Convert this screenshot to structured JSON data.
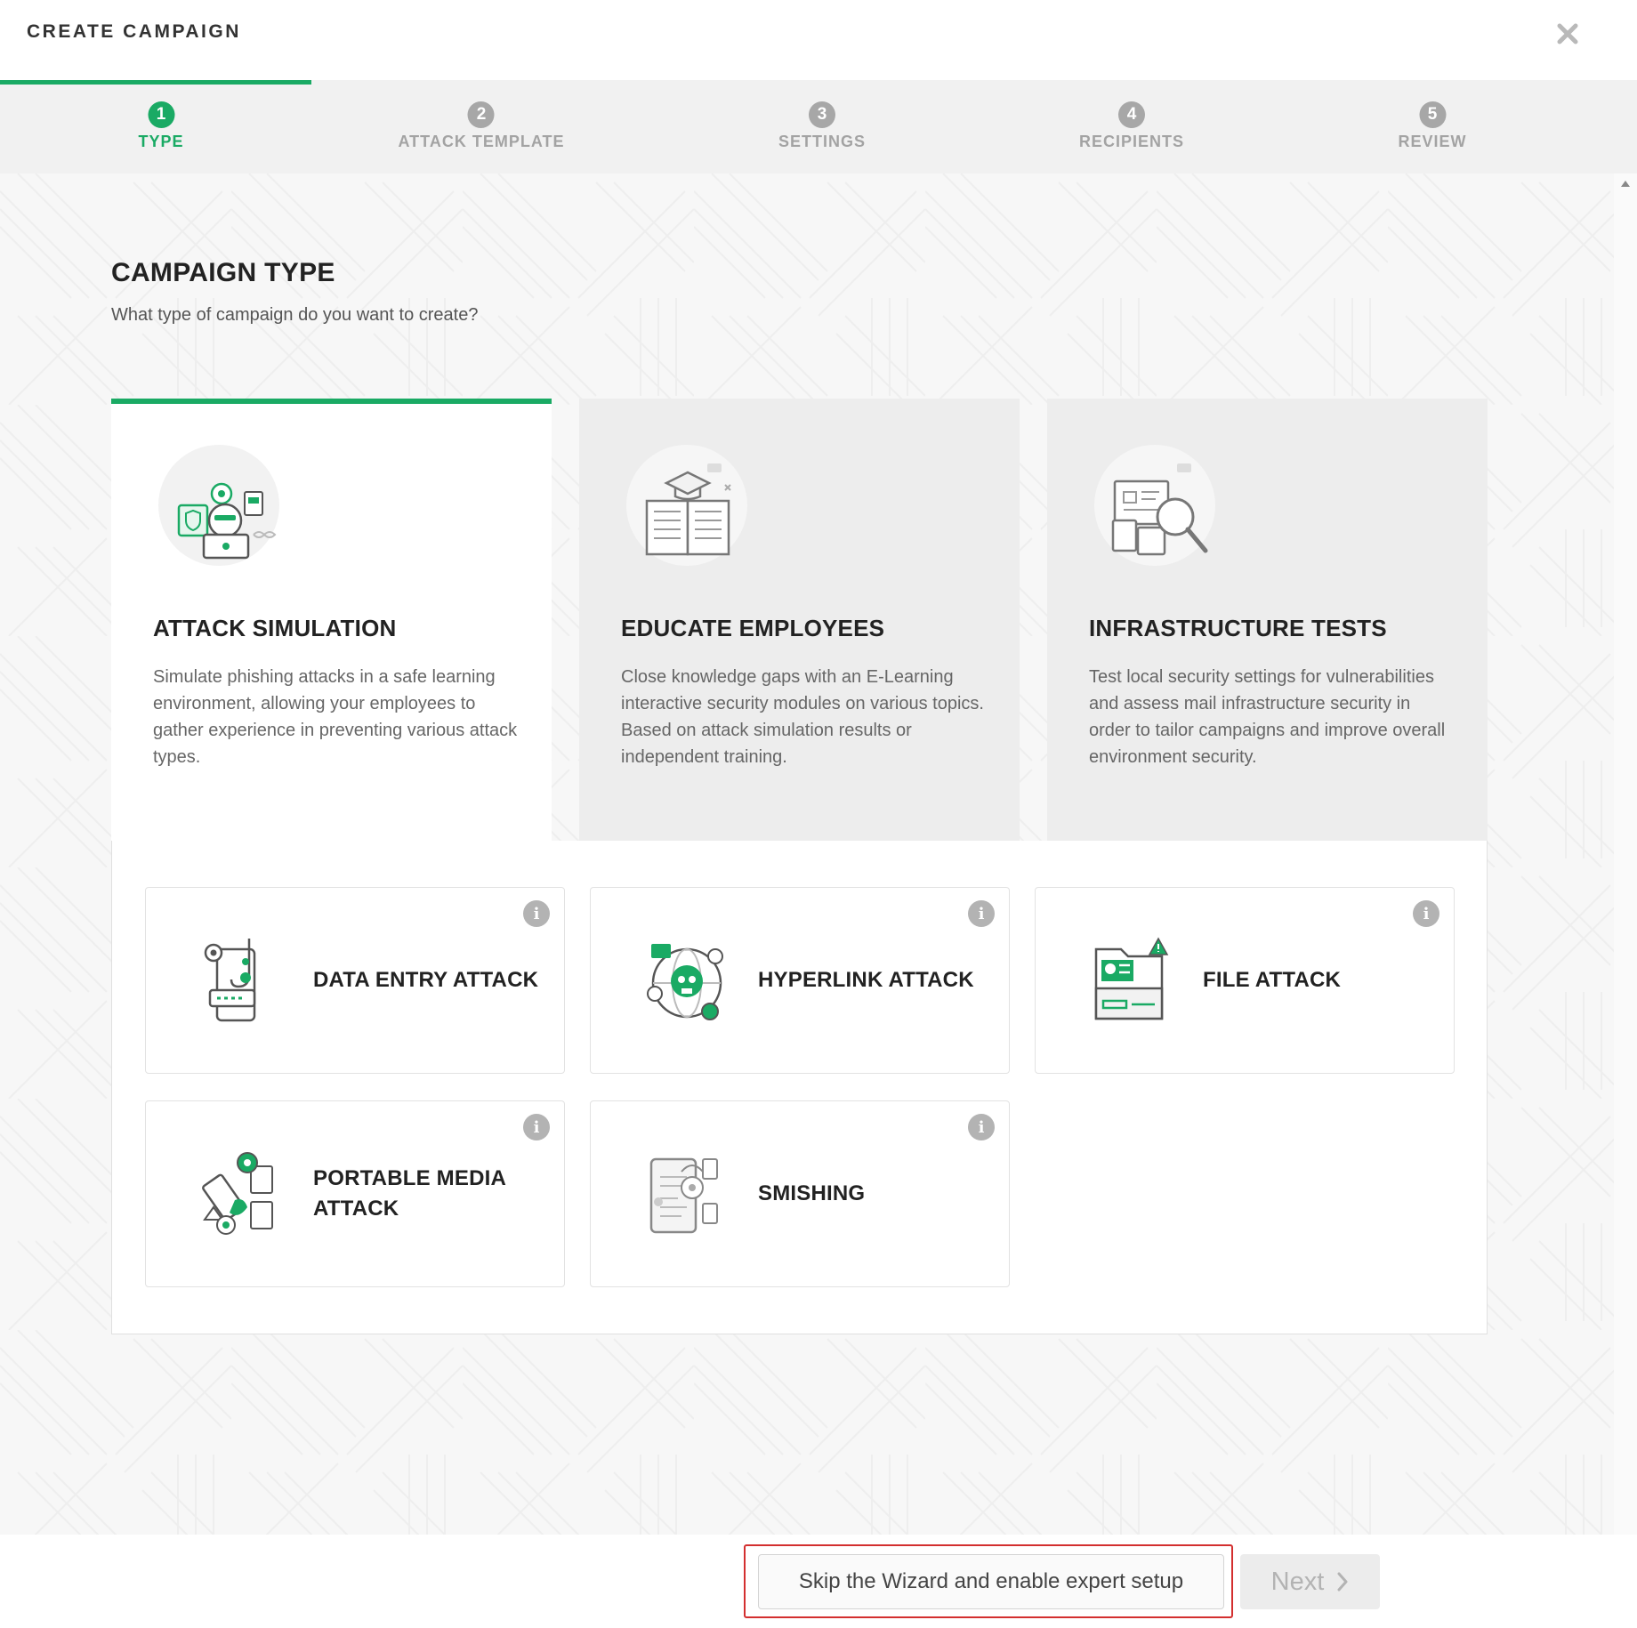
{
  "header": {
    "title": "CREATE CAMPAIGN",
    "close_icon": "close-icon"
  },
  "stepper": {
    "progress_percent": 19,
    "steps": [
      {
        "number": "1",
        "label": "TYPE",
        "active": true
      },
      {
        "number": "2",
        "label": "ATTACK TEMPLATE",
        "active": false
      },
      {
        "number": "3",
        "label": "SETTINGS",
        "active": false
      },
      {
        "number": "4",
        "label": "RECIPIENTS",
        "active": false
      },
      {
        "number": "5",
        "label": "REVIEW",
        "active": false
      }
    ]
  },
  "main": {
    "title": "CAMPAIGN TYPE",
    "subtitle": "What type of campaign do you want to create?",
    "type_cards": [
      {
        "title": "ATTACK SIMULATION",
        "description": "Simulate phishing attacks in a safe learning environment, allowing your employees to gather experience in preventing various attack types.",
        "icon": "hacker-laptop-icon",
        "selected": true
      },
      {
        "title": "EDUCATE EMPLOYEES",
        "description": "Close knowledge gaps with an E-Learning interactive security modules on various topics. Based on attack simulation results or independent training.",
        "icon": "graduation-book-icon",
        "selected": false
      },
      {
        "title": "INFRASTRUCTURE TESTS",
        "description": "Test local security settings for vulnerabilities and assess mail infrastructure security in order to tailor campaigns and improve overall environment security.",
        "icon": "magnifier-documents-icon",
        "selected": false
      }
    ],
    "attack_options": [
      {
        "label": "DATA ENTRY ATTACK",
        "icon": "phone-hook-icon"
      },
      {
        "label": "HYPERLINK ATTACK",
        "icon": "skull-globe-icon"
      },
      {
        "label": "FILE ATTACK",
        "icon": "infected-folder-icon"
      },
      {
        "label": "PORTABLE MEDIA ATTACK",
        "icon": "usb-device-icon"
      },
      {
        "label": "SMISHING",
        "icon": "phone-message-icon"
      }
    ]
  },
  "footer": {
    "skip_label": "Skip the Wizard and enable expert setup",
    "next_label": "Next"
  },
  "colors": {
    "accent": "#1aaa64",
    "muted": "#a7a7a7",
    "highlight": "#d32f2f"
  }
}
